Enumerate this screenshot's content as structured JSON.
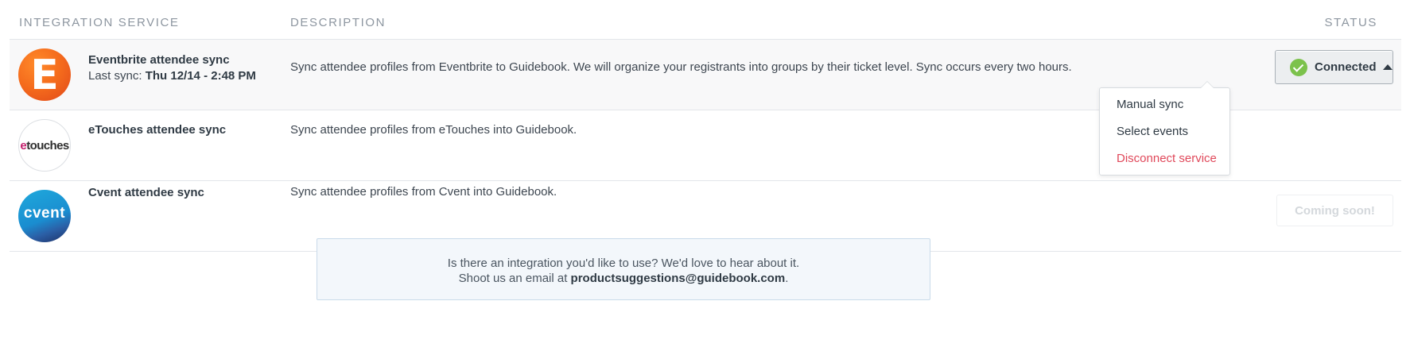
{
  "table": {
    "headers": {
      "service": "Integration Service",
      "description": "Description",
      "status": "Status"
    },
    "rows": [
      {
        "logo_text": "E",
        "name": "Eventbrite attendee sync",
        "last_sync_label": "Last sync:",
        "last_sync_value": "Thu 12/14 - 2:48 PM",
        "description": "Sync attendee profiles from Eventbrite to Guidebook. We will organize your registrants into groups by their ticket level. Sync occurs every two hours.",
        "status": {
          "label": "Connected",
          "icon": "check-circle-icon",
          "caret_icon": "caret-up-icon",
          "color": "#7cc24c"
        }
      },
      {
        "logo_text_e": "e",
        "logo_text_rest": "touches",
        "name": "eTouches attendee sync",
        "description": "Sync attendee profiles from eTouches into Guidebook."
      },
      {
        "logo_text": "cvent",
        "name": "Cvent attendee sync",
        "description": "Sync attendee profiles from Cvent into Guidebook.",
        "status": {
          "label": "Coming soon!"
        }
      }
    ]
  },
  "status_menu": {
    "items": [
      {
        "label": "Manual sync"
      },
      {
        "label": "Select events"
      },
      {
        "label": "Disconnect service",
        "color": "#e0485a"
      }
    ]
  },
  "info_box": {
    "line1": "Is there an integration you'd like to use? We'd love to hear about it.",
    "line2_prefix": "Shoot us an email at ",
    "email": "productsuggestions@guidebook.com",
    "line2_suffix": "."
  }
}
